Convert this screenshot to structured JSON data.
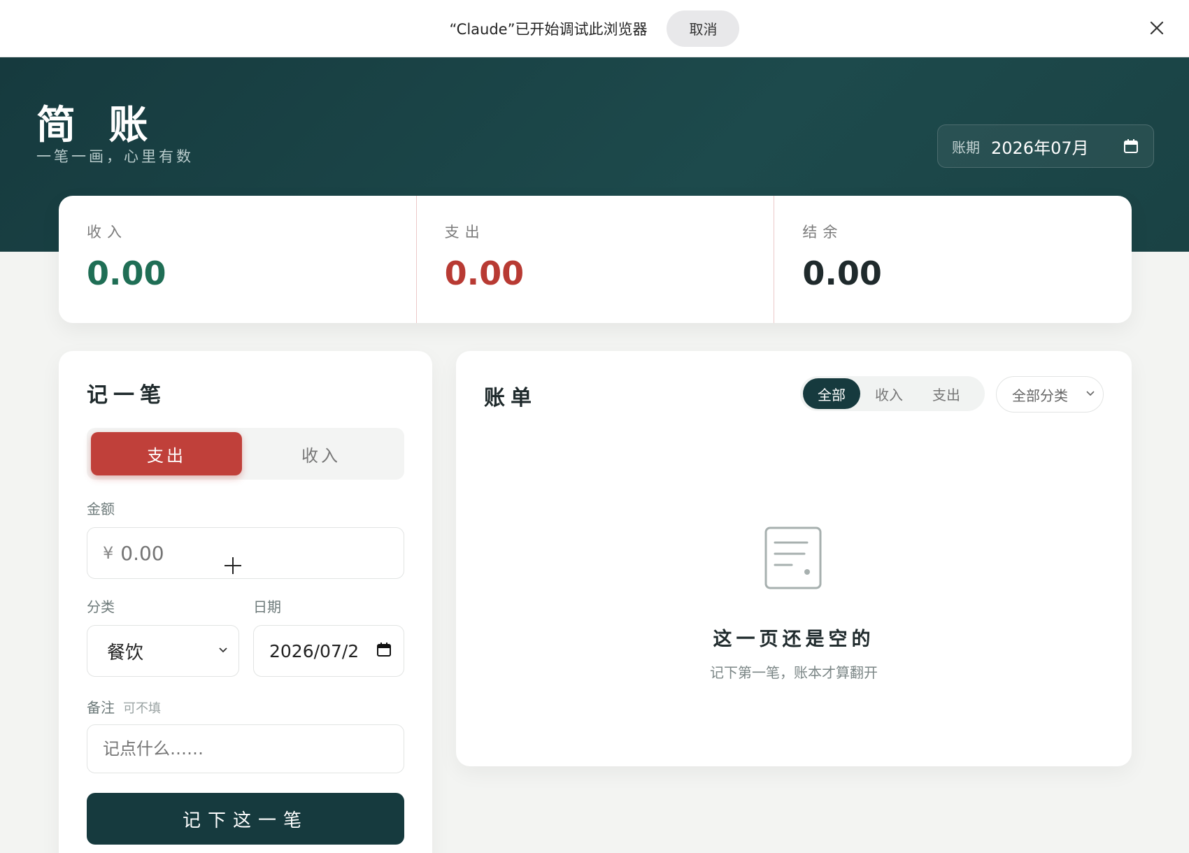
{
  "debug_bar": {
    "message": "“Claude”已开始调试此浏览器",
    "cancel_label": "取消"
  },
  "header": {
    "title": "简 账",
    "subtitle": "一笔一画，心里有数",
    "period_label": "账期",
    "period_value": "2026年07月"
  },
  "summary": {
    "income_label": "收入",
    "income_value": "0.00",
    "expense_label": "支出",
    "expense_value": "0.00",
    "balance_label": "结余",
    "balance_value": "0.00"
  },
  "form": {
    "title": "记一笔",
    "type_expense": "支出",
    "type_income": "收入",
    "amount_label": "金额",
    "amount_prefix": "¥",
    "amount_placeholder": "0.00",
    "category_label": "分类",
    "category_value": "餐饮",
    "date_label": "日期",
    "date_value": "2026/07/2",
    "note_label": "备注",
    "note_optional": "可不填",
    "note_placeholder": "记点什么……",
    "submit_label": "记下这一笔"
  },
  "bills": {
    "title": "账单",
    "filters": [
      "全部",
      "收入",
      "支出"
    ],
    "active_filter": "全部",
    "category_filter": "全部分类",
    "empty_title": "这一页还是空的",
    "empty_desc": "记下第一笔，账本才算翻开"
  },
  "colors": {
    "brand_dark": "#163a3e",
    "income": "#1f6e55",
    "expense": "#c0403a"
  }
}
